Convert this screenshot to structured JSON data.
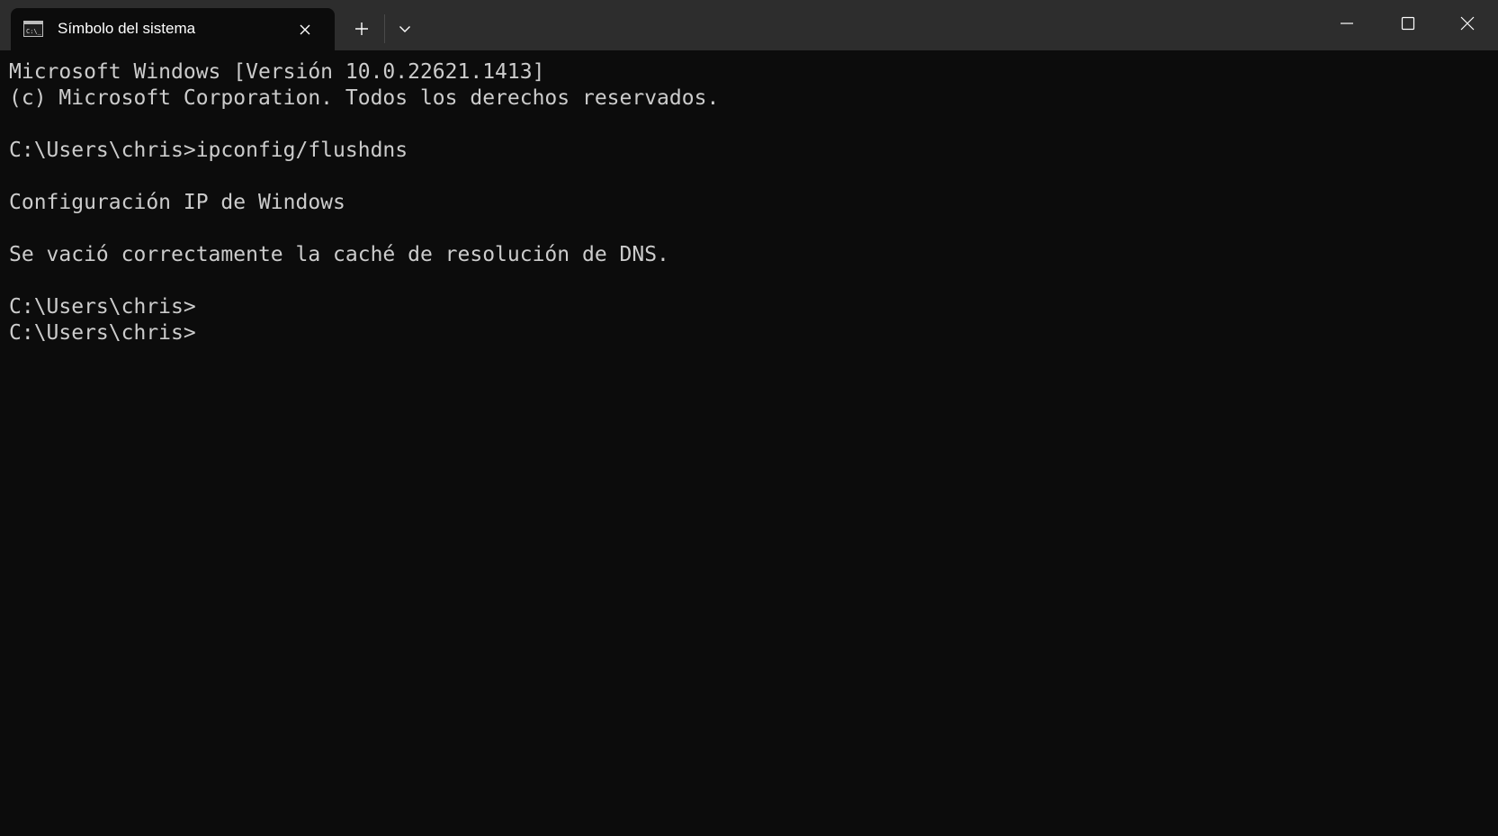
{
  "window": {
    "tab_title": "Símbolo del sistema"
  },
  "icons": {
    "tab": "cmd-prompt-icon",
    "tab_close": "close-icon",
    "new_tab": "plus-icon",
    "dropdown": "chevron-down-icon",
    "minimize": "minimize-icon",
    "maximize": "maximize-icon",
    "close": "close-icon"
  },
  "colors": {
    "titlebar": "#2d2d2d",
    "terminal_bg": "#0c0c0c",
    "terminal_text": "#cccccc"
  },
  "terminal": {
    "lines": [
      "Microsoft Windows [Versión 10.0.22621.1413]",
      "(c) Microsoft Corporation. Todos los derechos reservados.",
      "",
      "C:\\Users\\chris>ipconfig/flushdns",
      "",
      "Configuración IP de Windows",
      "",
      "Se vació correctamente la caché de resolución de DNS.",
      "",
      "C:\\Users\\chris>",
      "C:\\Users\\chris>"
    ]
  }
}
